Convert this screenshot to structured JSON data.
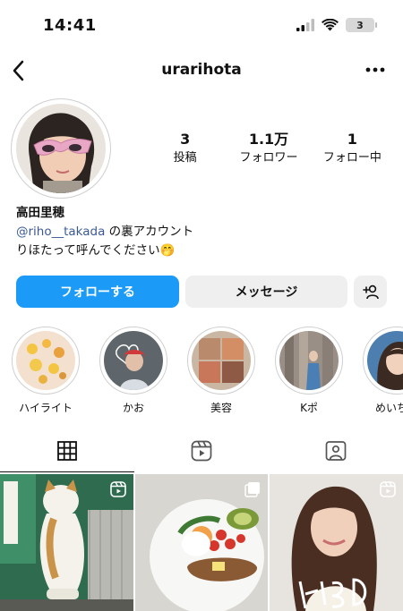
{
  "status": {
    "time": "14:41",
    "battery": "3"
  },
  "nav": {
    "username": "urarihota"
  },
  "profile": {
    "stats": [
      {
        "value": "3",
        "label": "投稿"
      },
      {
        "value": "1.1万",
        "label": "フォロワー"
      },
      {
        "value": "1",
        "label": "フォロー中"
      }
    ],
    "name": "高田里穂",
    "bio_mention": "@riho__takada",
    "bio_mention_suffix": " の裏アカウント",
    "bio_line2": "りほたって呼んでください🤭"
  },
  "actions": {
    "follow": "フォローする",
    "message": "メッセージ"
  },
  "highlights": [
    {
      "label": "ハイライト"
    },
    {
      "label": "かお"
    },
    {
      "label": "美容"
    },
    {
      "label": "Kポ"
    },
    {
      "label": "めいちゃ"
    }
  ],
  "tabs": [
    "grid-icon",
    "reels-icon",
    "tagged-icon"
  ],
  "colors": {
    "accent": "#1b9af7",
    "link": "#3b5a94"
  }
}
